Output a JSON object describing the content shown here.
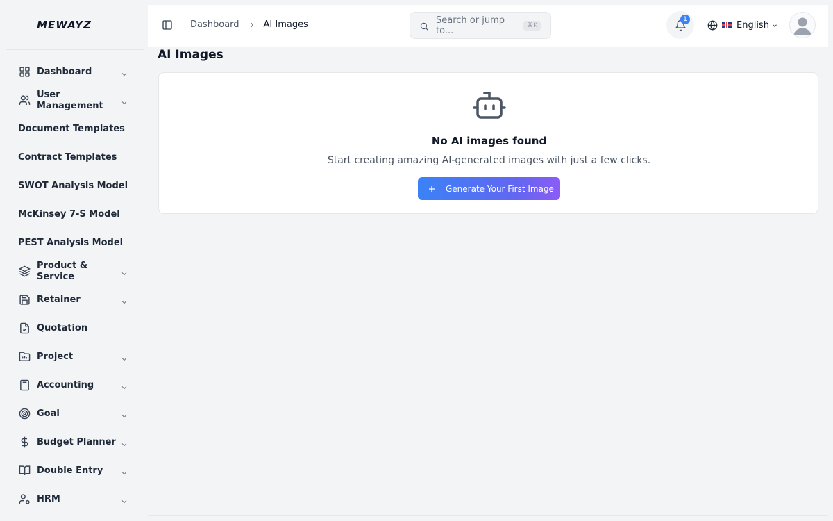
{
  "brand": {
    "name": "MEWAYZ"
  },
  "sidebar": {
    "items": [
      {
        "label": "Dashboard",
        "icon": "grid-icon",
        "has_chevron": true
      },
      {
        "label": "User Management",
        "icon": "users-icon",
        "has_chevron": true
      },
      {
        "label": "Document Templates",
        "icon": "",
        "has_chevron": false
      },
      {
        "label": "Contract Templates",
        "icon": "",
        "has_chevron": false
      },
      {
        "label": "SWOT Analysis Model",
        "icon": "",
        "has_chevron": false
      },
      {
        "label": "McKinsey 7-S Model",
        "icon": "",
        "has_chevron": false
      },
      {
        "label": "PEST Analysis Model",
        "icon": "",
        "has_chevron": false
      },
      {
        "label": "Product & Service",
        "icon": "layers-icon",
        "has_chevron": true
      },
      {
        "label": "Retainer",
        "icon": "save-icon",
        "has_chevron": true
      },
      {
        "label": "Quotation",
        "icon": "file-check-icon",
        "has_chevron": false
      },
      {
        "label": "Project",
        "icon": "folder-chart-icon",
        "has_chevron": true
      },
      {
        "label": "Accounting",
        "icon": "calculator-icon",
        "has_chevron": true
      },
      {
        "label": "Goal",
        "icon": "target-icon",
        "has_chevron": true
      },
      {
        "label": "Budget Planner",
        "icon": "dollar-icon",
        "has_chevron": true
      },
      {
        "label": "Double Entry",
        "icon": "book-icon",
        "has_chevron": true
      },
      {
        "label": "HRM",
        "icon": "user-cog-icon",
        "has_chevron": true
      }
    ]
  },
  "header": {
    "breadcrumb": {
      "parent": "Dashboard",
      "current": "AI Images"
    },
    "search": {
      "placeholder": "Search or jump to...",
      "shortcut": "⌘K"
    },
    "notifications": {
      "count": "1"
    },
    "language": {
      "label": "English",
      "flag": "uk-flag"
    }
  },
  "main": {
    "title": "AI Images",
    "empty_state": {
      "icon": "robot-icon",
      "title": "No AI images found",
      "subtitle": "Start creating amazing AI-generated images with just a few clicks.",
      "button_label": "Generate Your First Image"
    }
  },
  "colors": {
    "accent": "#3b82f6",
    "gradient_end": "#8b5cf6",
    "background": "#f3f4f6",
    "surface": "#ffffff"
  }
}
